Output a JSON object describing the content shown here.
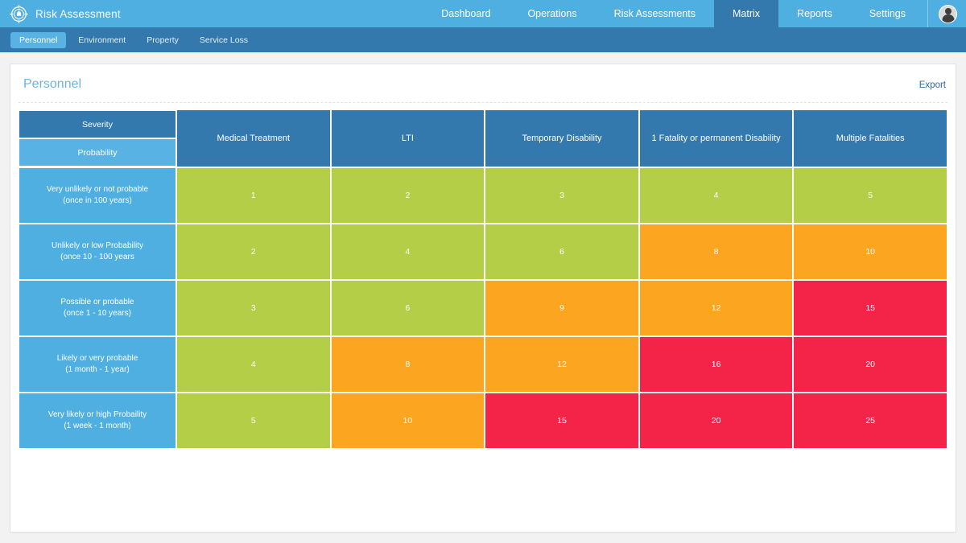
{
  "app": {
    "title": "Risk Assessment",
    "logo_icon": "target-crosshair-icon",
    "avatar_icon": "user-avatar-icon"
  },
  "topnav": {
    "items": [
      {
        "label": "Dashboard",
        "active": false
      },
      {
        "label": "Operations",
        "active": false
      },
      {
        "label": "Risk Assessments",
        "active": false
      },
      {
        "label": "Matrix",
        "active": true
      },
      {
        "label": "Reports",
        "active": false
      },
      {
        "label": "Settings",
        "active": false
      }
    ]
  },
  "subnav": {
    "items": [
      {
        "label": "Personnel",
        "active": true
      },
      {
        "label": "Environment",
        "active": false
      },
      {
        "label": "Property",
        "active": false
      },
      {
        "label": "Service Loss",
        "active": false
      }
    ]
  },
  "card": {
    "title": "Personnel",
    "export_label": "Export"
  },
  "matrix": {
    "corner_severity_label": "Severity",
    "corner_probability_label": "Probability",
    "columns": [
      "Medical Treatment",
      "LTI",
      "Temporary Disability",
      "1 Fatality or permanent Disability",
      "Multiple Fatalities"
    ],
    "rows": [
      {
        "line1": "Very unlikely or not probable",
        "line2": "(once in 100 years)"
      },
      {
        "line1": "Unlikely or low Probability",
        "line2": "(once 10 - 100 years"
      },
      {
        "line1": "Possible or probable",
        "line2": "(once 1 - 10 years)"
      },
      {
        "line1": "Likely or very probable",
        "line2": "(1 month - 1 year)"
      },
      {
        "line1": "Very likely or high Probaility",
        "line2": "(1 week - 1 month)"
      }
    ],
    "cells": [
      [
        {
          "value": "1",
          "level": "green"
        },
        {
          "value": "2",
          "level": "green"
        },
        {
          "value": "3",
          "level": "green"
        },
        {
          "value": "4",
          "level": "green"
        },
        {
          "value": "5",
          "level": "green"
        }
      ],
      [
        {
          "value": "2",
          "level": "green"
        },
        {
          "value": "4",
          "level": "green"
        },
        {
          "value": "6",
          "level": "green"
        },
        {
          "value": "8",
          "level": "orange"
        },
        {
          "value": "10",
          "level": "orange"
        }
      ],
      [
        {
          "value": "3",
          "level": "green"
        },
        {
          "value": "6",
          "level": "green"
        },
        {
          "value": "9",
          "level": "orange"
        },
        {
          "value": "12",
          "level": "orange"
        },
        {
          "value": "15",
          "level": "red"
        }
      ],
      [
        {
          "value": "4",
          "level": "green"
        },
        {
          "value": "8",
          "level": "orange"
        },
        {
          "value": "12",
          "level": "orange"
        },
        {
          "value": "16",
          "level": "red"
        },
        {
          "value": "20",
          "level": "red"
        }
      ],
      [
        {
          "value": "5",
          "level": "green"
        },
        {
          "value": "10",
          "level": "orange"
        },
        {
          "value": "15",
          "level": "red"
        },
        {
          "value": "20",
          "level": "red"
        },
        {
          "value": "25",
          "level": "red"
        }
      ]
    ]
  },
  "colors": {
    "topbar": "#4fafe0",
    "subbar": "#3479ad",
    "header_dark": "#3479ad",
    "row_header": "#4fafe0",
    "low": "#b5ce47",
    "medium": "#fba521",
    "high": "#f42348",
    "page_bg": "#f2f2f2",
    "title": "#6fb4e0",
    "link": "#2b6ca3"
  }
}
